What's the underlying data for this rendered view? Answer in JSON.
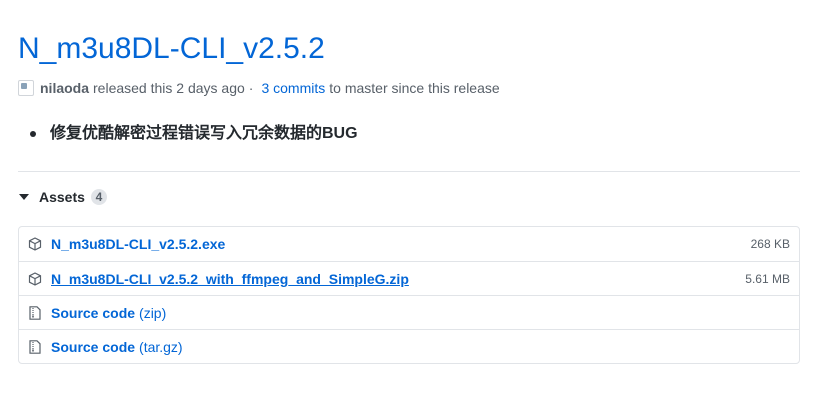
{
  "release": {
    "title": "N_m3u8DL-CLI_v2.5.2",
    "author": "nilaoda",
    "released_text": "released this 2 days ago",
    "separator": "·",
    "commits_link": "3 commits",
    "master_text": "to master since this release"
  },
  "notes": [
    "修复优酷解密过程错误写入冗余数据的BUG"
  ],
  "assets": {
    "heading": "Assets",
    "count": "4",
    "items": [
      {
        "name": "N_m3u8DL-CLI_v2.5.2.exe",
        "size": "268 KB",
        "icon": "package-icon"
      },
      {
        "name": "N_m3u8DL-CLI_v2.5.2_with_ffmpeg_and_SimpleG.zip",
        "size": "5.61 MB",
        "icon": "package-icon"
      }
    ],
    "source": [
      {
        "label": "Source code",
        "suffix": "(zip)",
        "icon": "file-zip-icon"
      },
      {
        "label": "Source code",
        "suffix": "(tar.gz)",
        "icon": "file-zip-icon"
      }
    ]
  },
  "colors": {
    "link": "#0366d6",
    "text": "#24292e",
    "muted": "#586069",
    "border": "#e1e4e8"
  }
}
